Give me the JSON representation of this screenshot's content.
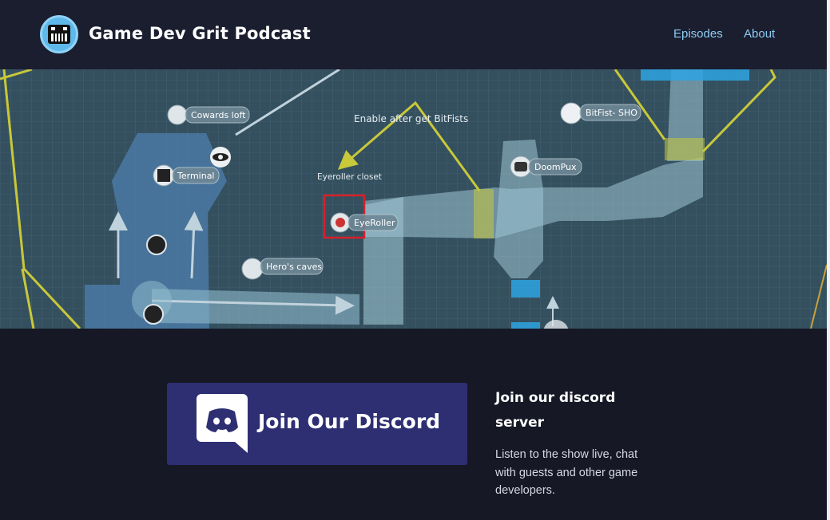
{
  "header": {
    "site_title": "Game Dev Grit Podcast",
    "nav": [
      {
        "label": "Episodes"
      },
      {
        "label": "About"
      }
    ]
  },
  "hero_map": {
    "labels": {
      "cowards_loft": "Cowards loft",
      "terminal": "Terminal",
      "enable_note": "Enable after get BitFists",
      "eyeroller_closet": "Eyeroller closet",
      "eyeroller": "EyeRoller",
      "heros_caves": "Hero's caves",
      "bitfist": "BitFist- SHO",
      "doompux": "DoomPux"
    }
  },
  "discord": {
    "banner_text": "Join Our Discord",
    "heading": "Join our discord server",
    "body": "Listen to the show live, chat with guests and other game developers."
  },
  "colors": {
    "header_bg": "#1b1e2f",
    "page_bg": "#161826",
    "accent_link": "#8ecbf3",
    "discord_banner": "#2e2f73"
  }
}
